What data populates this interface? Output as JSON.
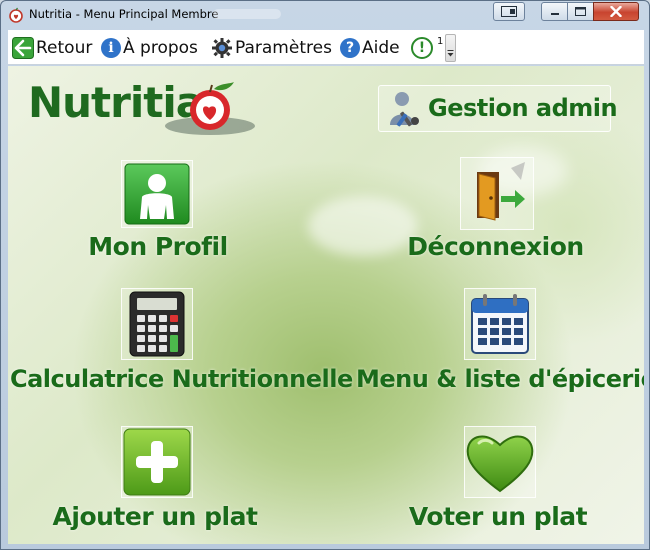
{
  "window": {
    "title": "Nutritia - Menu Principal Membre"
  },
  "menubar": {
    "back": "Retour",
    "about": "À propos",
    "settings": "Paramètres",
    "help": "Aide",
    "notifications_count": "1"
  },
  "logo": {
    "text": "Nutritia"
  },
  "admin": {
    "label": "Gestion admin"
  },
  "tiles": {
    "profile": "Mon Profil",
    "logout": "Déconnexion",
    "calculator": "Calculatrice Nutritionnelle",
    "menu_list": "Menu & liste d'épicerie",
    "add_dish": "Ajouter un plat",
    "vote_dish": "Voter un plat"
  },
  "colors": {
    "label_green": "#1a6b1a",
    "close_red": "#c8442f"
  }
}
